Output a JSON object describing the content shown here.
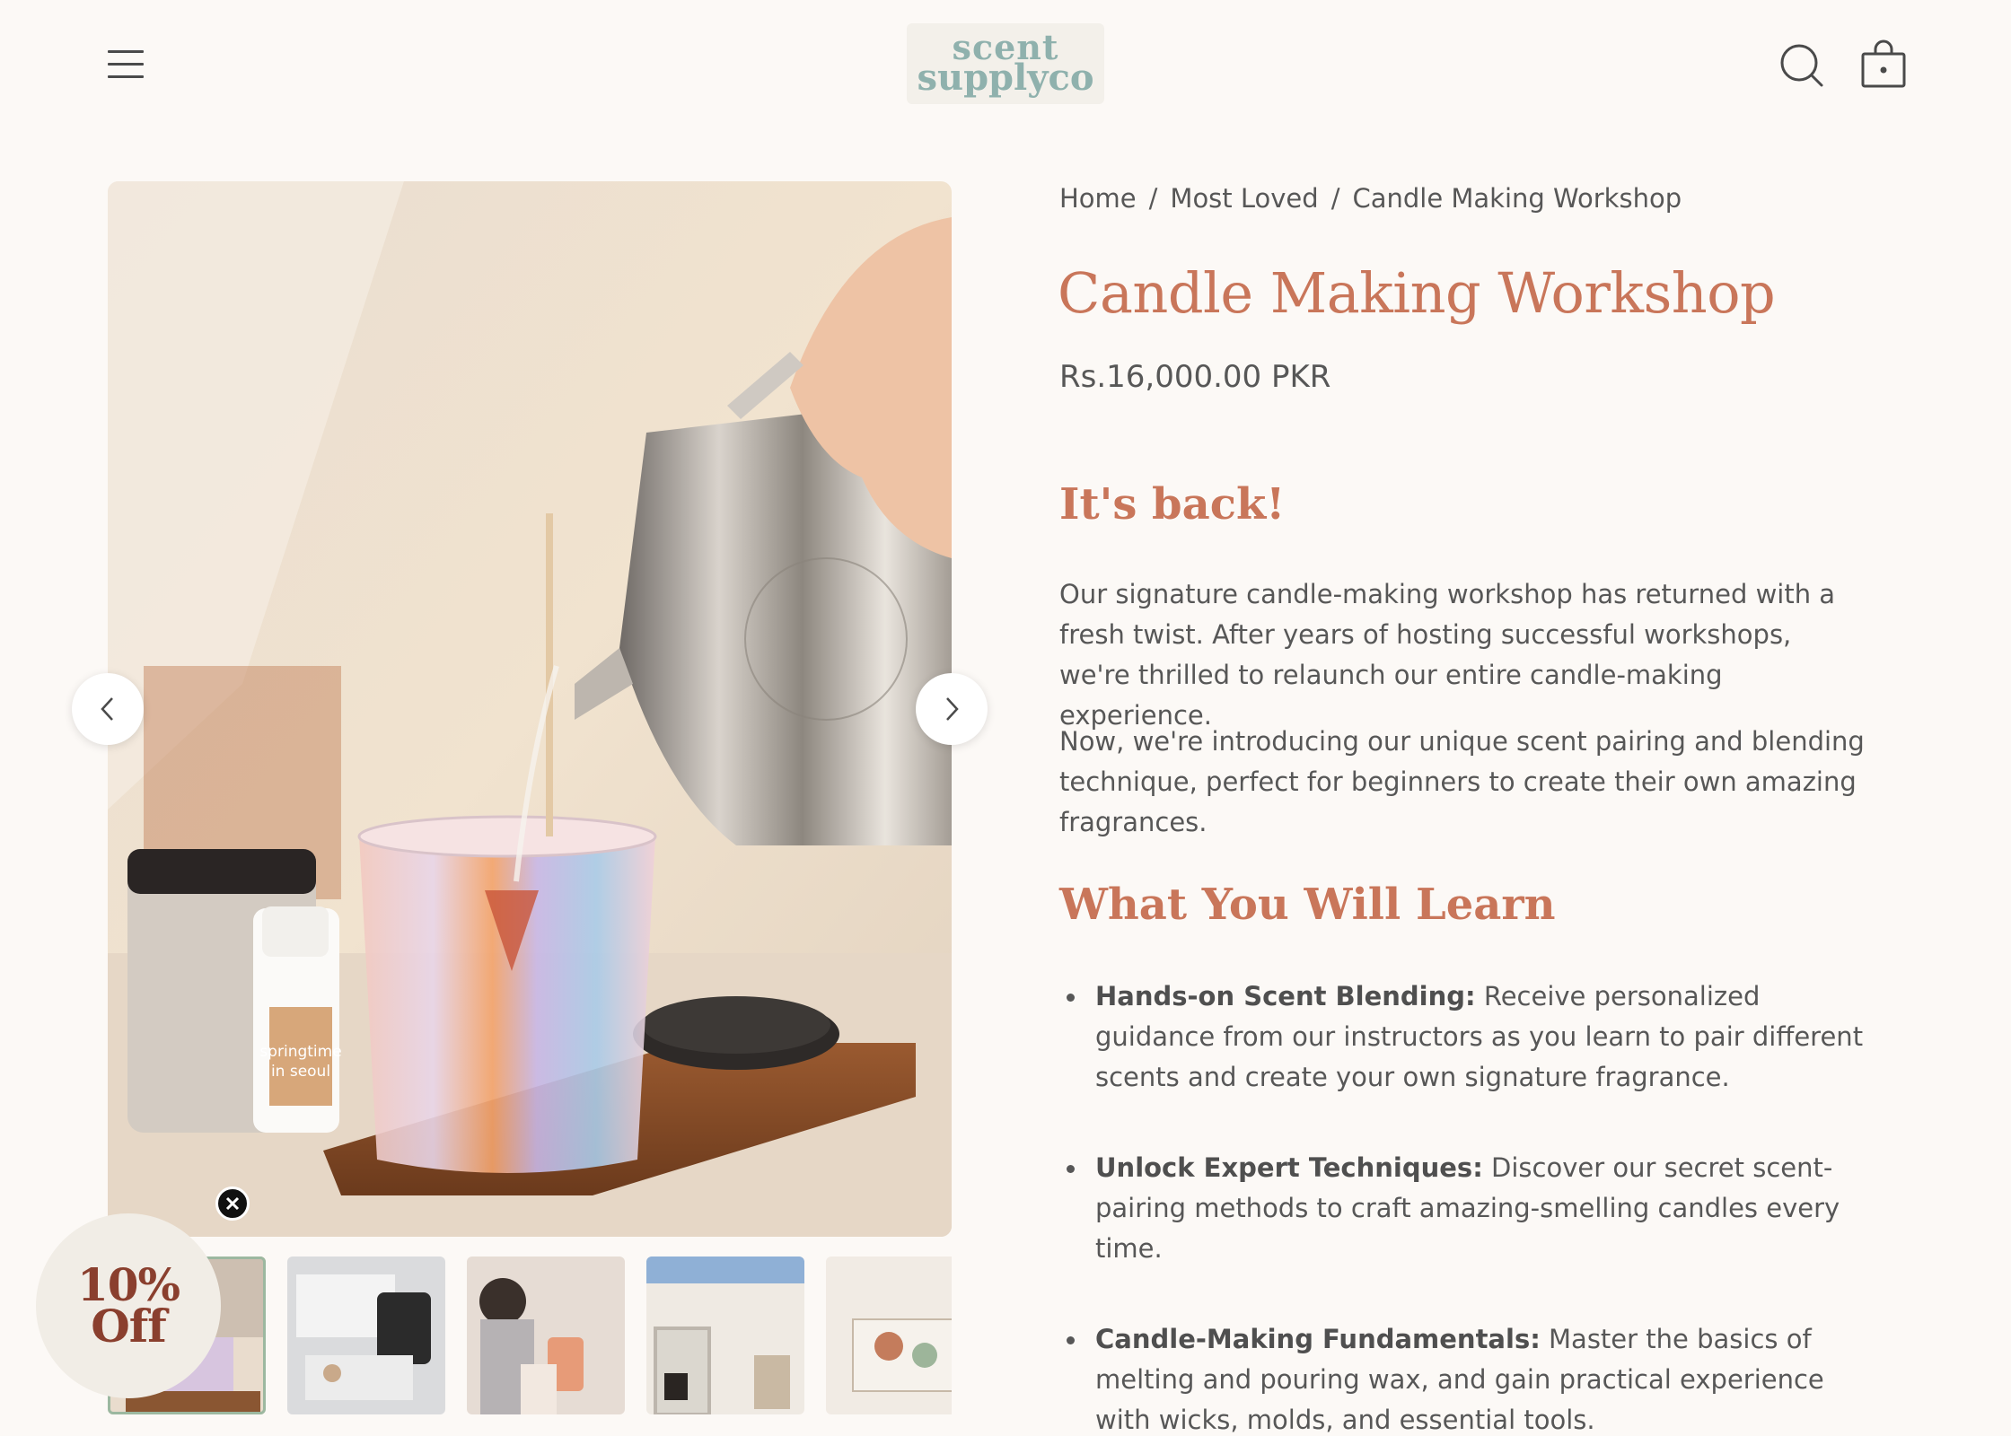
{
  "header": {
    "menu_icon": "hamburger-menu-icon",
    "logo_line1": "scent",
    "logo_line2": "supplyco",
    "search_icon": "search-icon",
    "cart_icon": "shopping-bag-icon"
  },
  "breadcrumb": [
    "Home",
    "Most Loved",
    "Candle Making Workshop"
  ],
  "breadcrumb_separator": "/",
  "product": {
    "title": "Candle Making Workshop",
    "price": "Rs.16,000.00 PKR"
  },
  "sections": {
    "back_heading": "It's back!",
    "paragraph1": "Our signature candle-making workshop has returned with a fresh twist. After years of hosting successful workshops, we're thrilled to relaunch our entire candle-making experience.",
    "paragraph2": "Now, we're introducing our unique scent pairing and blending technique, perfect for beginners to create their own amazing fragrances.",
    "learn_heading": "What You Will Learn",
    "learn_items": [
      {
        "bold": "Hands-on Scent Blending:",
        "text": " Receive personalized guidance from our instructors as you learn to pair different scents and create your own signature fragrance."
      },
      {
        "bold": "Unlock Expert Techniques:",
        "text": " Discover our secret scent-pairing methods to craft amazing-smelling candles every time."
      },
      {
        "bold": "Candle-Making Fundamentals:",
        "text": " Master the basics of melting and pouring wax, and gain practical experience with wicks, molds, and essential tools."
      }
    ]
  },
  "gallery": {
    "main_image_text": "springtime in seoul",
    "prev_icon": "chevron-left-icon",
    "next_icon": "chevron-right-icon",
    "thumbnail_count": 5,
    "active_thumbnail": 1
  },
  "promo": {
    "line1": "10%",
    "line2": "Off",
    "close_icon": "close-icon"
  },
  "colors": {
    "background": "#fcf9f6",
    "accent": "#c9765a",
    "text": "#575757",
    "logo": "#8fb1ad"
  }
}
